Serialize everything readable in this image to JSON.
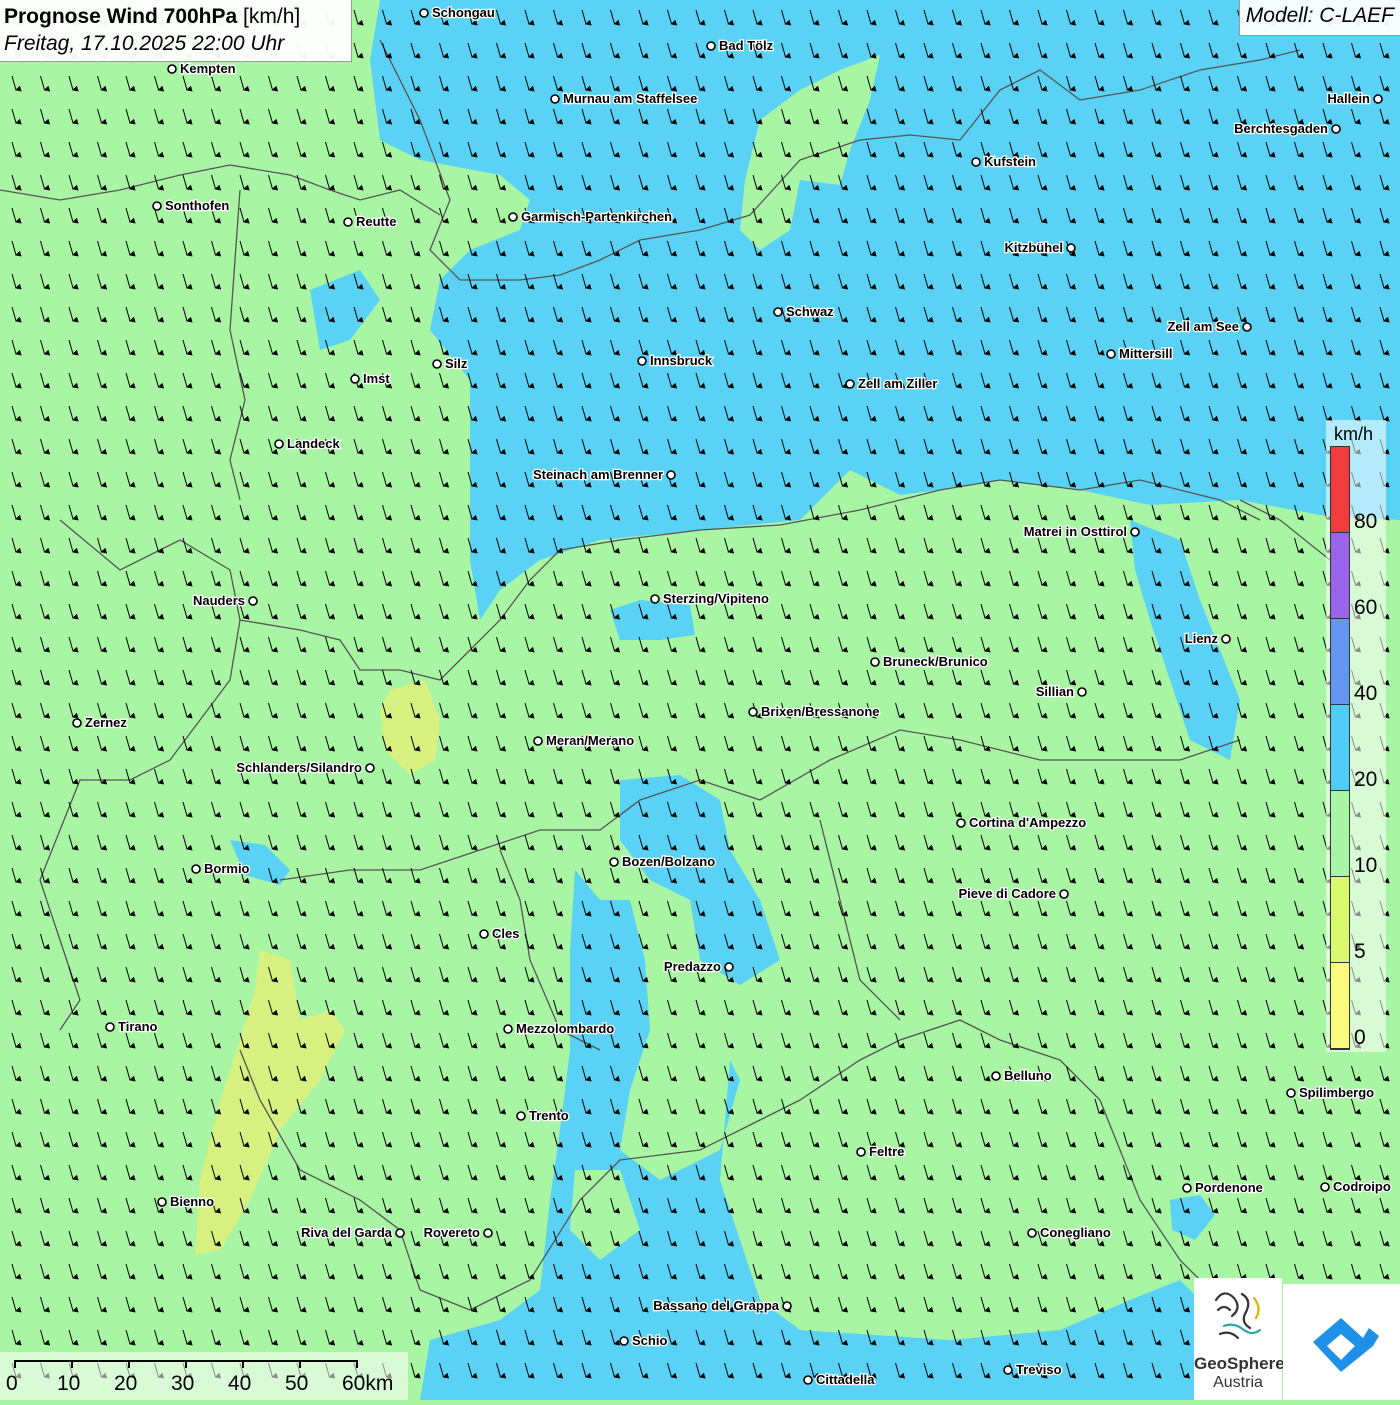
{
  "header": {
    "title_bold": "Prognose Wind 700hPa",
    "title_unit": "[km/h]",
    "datetime": "Freitag, 17.10.2025 22:00 Uhr",
    "model": "Modell: C-LAEF"
  },
  "legend": {
    "unit": "km/h",
    "classes": [
      {
        "label": "0",
        "color": "#fafa7d"
      },
      {
        "label": "5",
        "color": "#d9fa6e"
      },
      {
        "label": "10",
        "color": "#a8f5a4"
      },
      {
        "label": "20",
        "color": "#4fcdf7"
      },
      {
        "label": "40",
        "color": "#6496f0"
      },
      {
        "label": "60",
        "color": "#9a64ea"
      },
      {
        "label": "80",
        "color": "#f03c3c"
      }
    ]
  },
  "scale_bar": {
    "labels": [
      "0",
      "10",
      "20",
      "30",
      "40",
      "50",
      "60km"
    ]
  },
  "logos": {
    "geosphere_line1": "GeoSphere",
    "geosphere_line2": "Austria"
  },
  "colors": {
    "background_wind": "#a8f5a4",
    "blue_wind": "#5ad2f5",
    "yellow_wind": "#d8f080",
    "arrow": "#000000",
    "border": "#555555"
  },
  "cities": [
    {
      "name": "Schongau"
    },
    {
      "name": "Bad Tölz"
    },
    {
      "name": "Kempten"
    },
    {
      "name": "Murnau am Staffelsee"
    },
    {
      "name": "Hallein"
    },
    {
      "name": "Berchtesgaden"
    },
    {
      "name": "Kufstein"
    },
    {
      "name": "Sonthofen"
    },
    {
      "name": "Reutte"
    },
    {
      "name": "Garmisch-Partenkirchen"
    },
    {
      "name": "Kitzbühel"
    },
    {
      "name": "Schwaz"
    },
    {
      "name": "Zell am See"
    },
    {
      "name": "Mittersill"
    },
    {
      "name": "Innsbruck"
    },
    {
      "name": "Silz"
    },
    {
      "name": "Imst"
    },
    {
      "name": "Zell am Ziller"
    },
    {
      "name": "Landeck"
    },
    {
      "name": "Steinach am Brenner"
    },
    {
      "name": "Matrei in Osttirol"
    },
    {
      "name": "Nauders"
    },
    {
      "name": "Sterzing/Vipiteno"
    },
    {
      "name": "Lienz"
    },
    {
      "name": "Bruneck/Brunico"
    },
    {
      "name": "Sillian"
    },
    {
      "name": "Zernez"
    },
    {
      "name": "Brixen/Bressanone"
    },
    {
      "name": "Meran/Merano"
    },
    {
      "name": "Schlanders/Silandro"
    },
    {
      "name": "Cortina d'Ampezzo"
    },
    {
      "name": "Bozen/Bolzano"
    },
    {
      "name": "Bormio"
    },
    {
      "name": "Pieve di Cadore"
    },
    {
      "name": "Cles"
    },
    {
      "name": "Predazzo"
    },
    {
      "name": "Tirano"
    },
    {
      "name": "Mezzolombardo"
    },
    {
      "name": "Belluno"
    },
    {
      "name": "Spilimbergo"
    },
    {
      "name": "Trento"
    },
    {
      "name": "Feltre"
    },
    {
      "name": "Pordenone"
    },
    {
      "name": "Codroipo"
    },
    {
      "name": "Bienno"
    },
    {
      "name": "Riva del Garda"
    },
    {
      "name": "Rovereto"
    },
    {
      "name": "Conegliano"
    },
    {
      "name": "Bassano del Grappa"
    },
    {
      "name": "Schio"
    },
    {
      "name": "Treviso"
    },
    {
      "name": "Cittadella"
    }
  ]
}
